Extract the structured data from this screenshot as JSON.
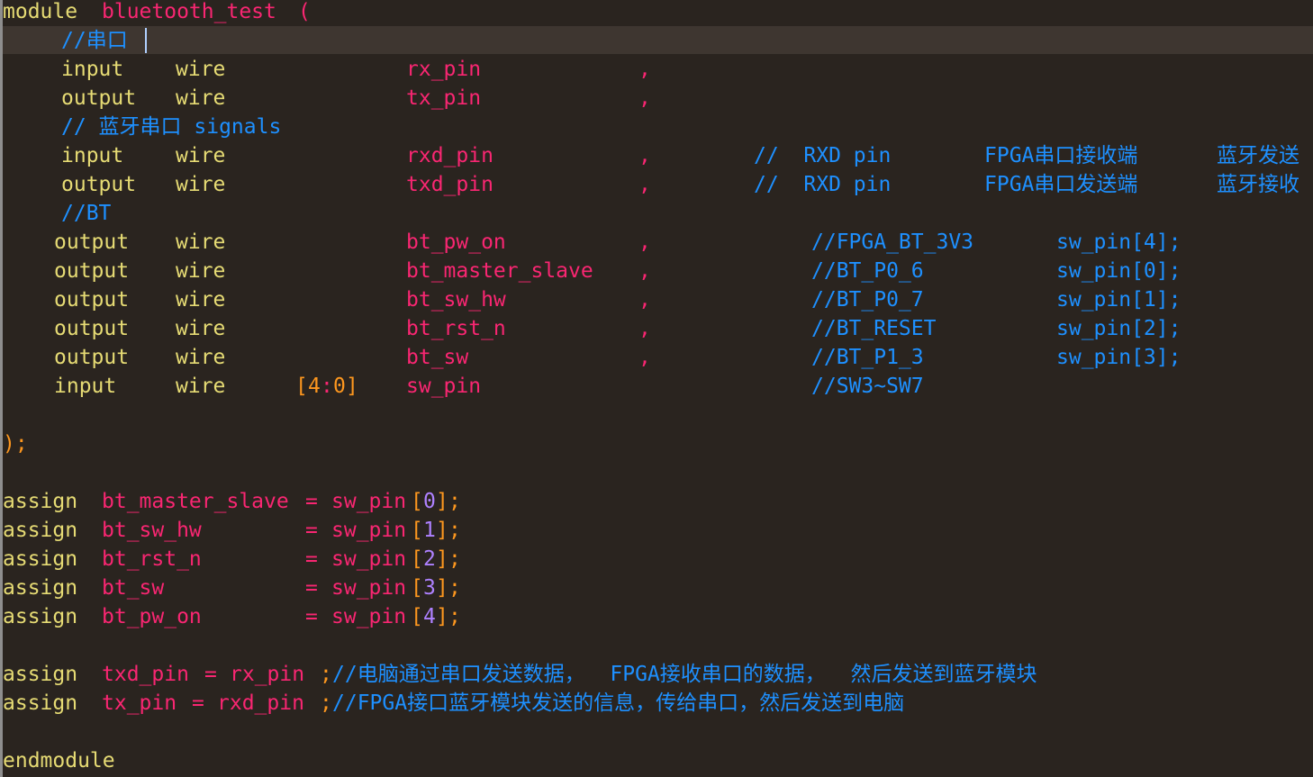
{
  "editor": {
    "lines": {
      "l1": {
        "module_kw": "module",
        "name": "bluetooth_test",
        "paren": "("
      },
      "l2": {
        "comment": "//串口"
      },
      "l3": {
        "dir": "input",
        "type": "wire",
        "name": "rx_pin",
        "sep": ","
      },
      "l4": {
        "dir": "output",
        "type": "wire",
        "name": "tx_pin",
        "sep": ","
      },
      "l5": {
        "comment": "// 蓝牙串口 signals"
      },
      "l6": {
        "dir": "input",
        "type": "wire",
        "name": "rxd_pin",
        "sep": ",",
        "comment1": "//  RXD pin",
        "comment2": "FPGA串口接收端",
        "comment3": "蓝牙发送"
      },
      "l7": {
        "dir": "output",
        "type": "wire",
        "name": "txd_pin",
        "sep": ",",
        "comment1": "//  RXD pin",
        "comment2": "FPGA串口发送端",
        "comment3": "蓝牙接收"
      },
      "l8": {
        "comment": "//BT"
      },
      "l9": {
        "dir": "output",
        "type": "wire",
        "name": "bt_pw_on",
        "sep": ",",
        "comment1": "//FPGA_BT_3V3",
        "comment2": "sw_pin[4];"
      },
      "l10": {
        "dir": "output",
        "type": "wire",
        "name": "bt_master_slave",
        "sep": ",",
        "comment1": "//BT_P0_6",
        "comment2": "sw_pin[0];"
      },
      "l11": {
        "dir": "output",
        "type": "wire",
        "name": "bt_sw_hw",
        "sep": ",",
        "comment1": "//BT_P0_7",
        "comment2": "sw_pin[1];"
      },
      "l12": {
        "dir": "output",
        "type": "wire",
        "name": "bt_rst_n",
        "sep": ",",
        "comment1": "//BT_RESET",
        "comment2": "sw_pin[2];"
      },
      "l13": {
        "dir": "output",
        "type": "wire",
        "name": "bt_sw",
        "sep": ",",
        "comment1": "//BT_P1_3",
        "comment2": "sw_pin[3];"
      },
      "l14": {
        "dir": "input",
        "type": "wire",
        "range_open": "[",
        "range_hi": "4",
        "range_colon": ":",
        "range_lo": "0",
        "range_close": "]",
        "name": "sw_pin",
        "comment1": "//SW3~SW7"
      },
      "l16": {
        "text": ");"
      },
      "l18": {
        "kw": "assign",
        "lhs": "bt_master_slave",
        "eq": "=",
        "rhs": "sw_pin",
        "bo": "[",
        "idx": "0",
        "bc": "]",
        "semi": ";"
      },
      "l19": {
        "kw": "assign",
        "lhs": "bt_sw_hw",
        "eq": "=",
        "rhs": "sw_pin",
        "bo": "[",
        "idx": "1",
        "bc": "]",
        "semi": ";"
      },
      "l20": {
        "kw": "assign",
        "lhs": "bt_rst_n",
        "eq": "=",
        "rhs": "sw_pin",
        "bo": "[",
        "idx": "2",
        "bc": "]",
        "semi": ";"
      },
      "l21": {
        "kw": "assign",
        "lhs": "bt_sw",
        "eq": "=",
        "rhs": "sw_pin",
        "bo": "[",
        "idx": "3",
        "bc": "]",
        "semi": ";"
      },
      "l22": {
        "kw": "assign",
        "lhs": "bt_pw_on",
        "eq": "=",
        "rhs": "sw_pin",
        "bo": "[",
        "idx": "4",
        "bc": "]",
        "semi": ";"
      },
      "l24": {
        "kw": "assign",
        "lhs": "txd_pin",
        "eq": "=",
        "rhs": "rx_pin",
        "semi": ";",
        "comment": "//电脑通过串口发送数据，  FPGA接收串口的数据，  然后发送到蓝牙模块"
      },
      "l25": {
        "kw": "assign",
        "lhs": "tx_pin",
        "eq": "=",
        "rhs": "rxd_pin",
        "semi": ";",
        "comment": "//FPGA接口蓝牙模块发送的信息，传给串口，然后发送到电脑"
      },
      "l27": {
        "kw": "endmodule"
      }
    }
  },
  "colors": {
    "background": "#2a241f",
    "current_line": "#3e3630",
    "keyword": "#e6db74",
    "identifier": "#f92672",
    "comment": "#1e90ff",
    "range": "#fd971f"
  }
}
